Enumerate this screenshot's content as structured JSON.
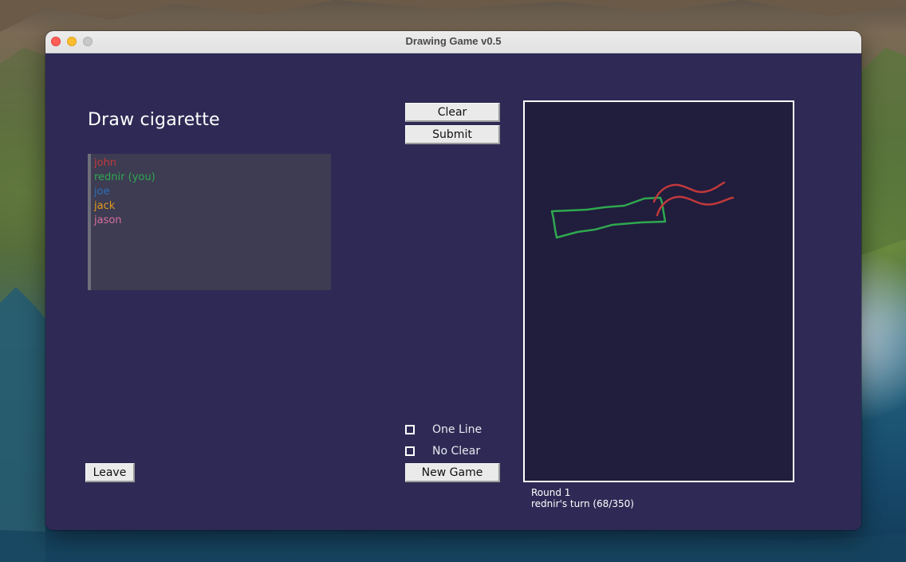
{
  "window": {
    "title": "Drawing Game v0.5"
  },
  "game": {
    "prompt": "Draw cigarette",
    "players": [
      {
        "name": "john",
        "color": "#c0393b"
      },
      {
        "name": "rednir (you)",
        "color": "#2fa84f"
      },
      {
        "name": "joe",
        "color": "#2f6fb8"
      },
      {
        "name": "jack",
        "color": "#e59a1e"
      },
      {
        "name": "jason",
        "color": "#d96f9c"
      }
    ]
  },
  "buttons": {
    "clear": "Clear",
    "submit": "Submit",
    "new_game": "New Game",
    "leave": "Leave"
  },
  "options": {
    "one_line": {
      "label": "One Line",
      "checked": false
    },
    "no_clear": {
      "label": "No Clear",
      "checked": false
    }
  },
  "status": {
    "round": "Round 1",
    "turn": "rednir's turn (68/350)"
  },
  "colors": {
    "window_bg": "#2e2a55",
    "canvas_bg": "#201d3d",
    "stroke_green": "#2fa84f",
    "stroke_red": "#c0393b"
  }
}
